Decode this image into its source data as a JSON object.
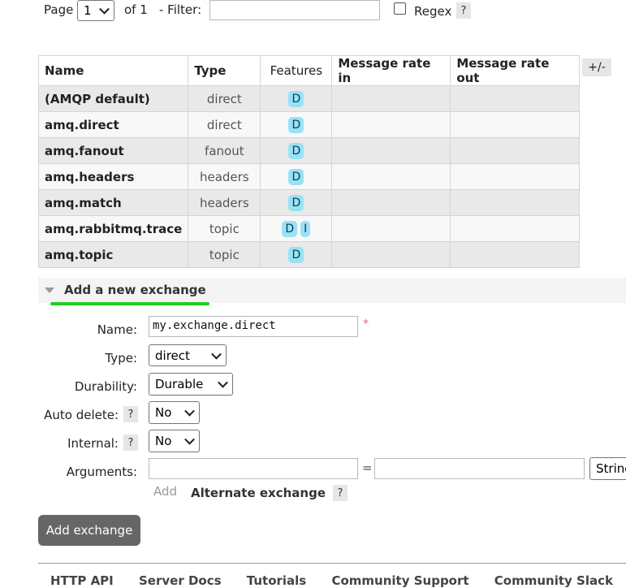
{
  "pager": {
    "page_label": "Page",
    "page_value": "1",
    "of_label": "of 1",
    "filter_label": "- Filter:",
    "filter_value": "",
    "regex_label": "Regex",
    "help": "?"
  },
  "table": {
    "headers": [
      "Name",
      "Type",
      "Features",
      "Message rate in",
      "Message rate out"
    ],
    "toggle_columns": "+/-",
    "rows": [
      {
        "name": "(AMQP default)",
        "type": "direct",
        "features": [
          "D"
        ]
      },
      {
        "name": "amq.direct",
        "type": "direct",
        "features": [
          "D"
        ]
      },
      {
        "name": "amq.fanout",
        "type": "fanout",
        "features": [
          "D"
        ]
      },
      {
        "name": "amq.headers",
        "type": "headers",
        "features": [
          "D"
        ]
      },
      {
        "name": "amq.match",
        "type": "headers",
        "features": [
          "D"
        ]
      },
      {
        "name": "amq.rabbitmq.trace",
        "type": "topic",
        "features": [
          "D",
          "I"
        ]
      },
      {
        "name": "amq.topic",
        "type": "topic",
        "features": [
          "D"
        ]
      }
    ]
  },
  "add_section": {
    "title": "Add a new exchange",
    "underline_color": "#22cc22",
    "name_label": "Name:",
    "name_value": "my.exchange.direct",
    "required_mark": "*",
    "type_label": "Type:",
    "type_value": "direct",
    "durability_label": "Durability:",
    "durability_value": "Durable",
    "auto_delete_label": "Auto delete:",
    "auto_delete_value": "No",
    "internal_label": "Internal:",
    "internal_value": "No",
    "arguments_label": "Arguments:",
    "equals": "=",
    "arg_type_value": "String",
    "add_link": "Add",
    "alternate_exchange": "Alternate exchange",
    "help": "?",
    "submit": "Add exchange"
  },
  "footer": {
    "links": [
      "HTTP API",
      "Server Docs",
      "Tutorials",
      "Community Support",
      "Community Slack"
    ]
  }
}
